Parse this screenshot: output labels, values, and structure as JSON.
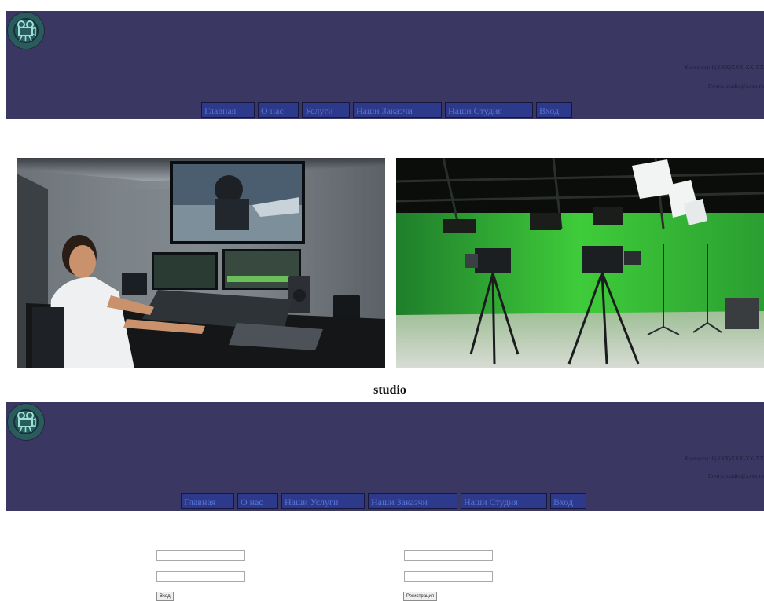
{
  "header_top": {
    "logo_icon": "film-camera-icon",
    "contact_line_1": "Контакты: 8(XXX)XXX-XX-XX",
    "contact_line_2": "Почта: studio@xxxx.ru",
    "nav": [
      "Главная",
      "О нас",
      "Услуги",
      "Наши Заказчи",
      "Наши Студия",
      "Вход"
    ]
  },
  "photos": [
    {
      "alt": "editing-suite-photo"
    },
    {
      "alt": "green-screen-studio-photo"
    }
  ],
  "caption": "studio",
  "header_bottom": {
    "logo_icon": "film-camera-icon",
    "contact_line_1": "Контакты: 8(XXX)XXX-XX-XX",
    "contact_line_2": "Почта: studio@xxxx.ru",
    "nav": [
      "Главная",
      "О нас",
      "Наши Услуги",
      "Наши Заказчи",
      "Наши Студия",
      "Вход"
    ]
  },
  "login_form": {
    "login_value": "",
    "password_value": "",
    "submit_label": "Вход"
  },
  "register_form": {
    "login_value": "",
    "password_value": "",
    "submit_label": "Регистрация"
  },
  "colors": {
    "header_bg": "#3b3763",
    "nav_bg": "#2d3a8c",
    "nav_text": "#5672d6",
    "logo_bg": "#2a5c5e"
  }
}
